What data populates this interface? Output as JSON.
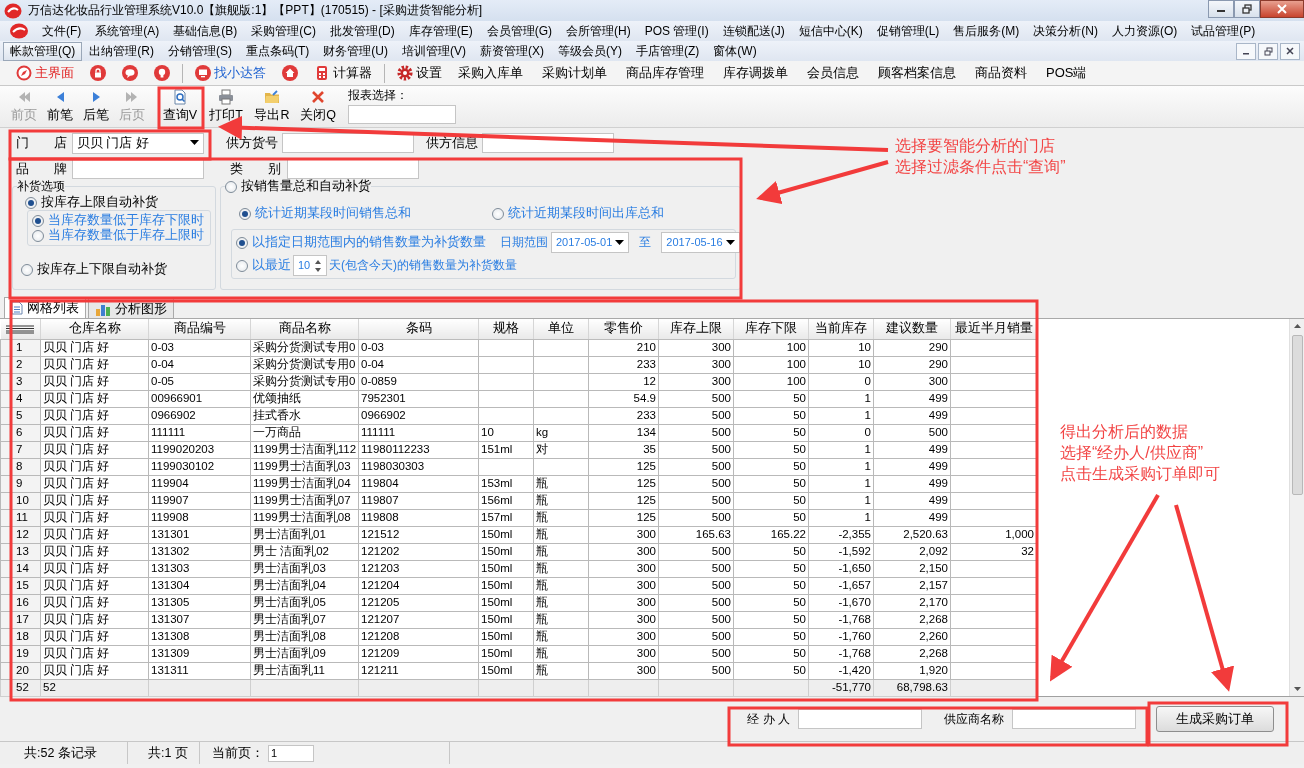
{
  "window": {
    "title": "万信达化妆品行业管理系统V10.0【旗舰版:1】【PPT】(170515) - [采购进货智能分析]"
  },
  "menu_rows": [
    [
      {
        "label": "文件(F)",
        "selected": false
      },
      {
        "label": "系统管理(A)",
        "selected": false
      },
      {
        "label": "基础信息(B)",
        "selected": false
      },
      {
        "label": "采购管理(C)",
        "selected": false
      },
      {
        "label": "批发管理(D)",
        "selected": false
      },
      {
        "label": "库存管理(E)",
        "selected": false
      },
      {
        "label": "会员管理(G)",
        "selected": false
      },
      {
        "label": "会所管理(H)",
        "selected": false
      },
      {
        "label": "POS 管理(I)",
        "selected": false
      },
      {
        "label": "连锁配送(J)",
        "selected": false
      },
      {
        "label": "短信中心(K)",
        "selected": false
      },
      {
        "label": "促销管理(L)",
        "selected": false
      },
      {
        "label": "售后服务(M)",
        "selected": false
      },
      {
        "label": "决策分析(N)",
        "selected": false
      },
      {
        "label": "人力资源(O)",
        "selected": false
      },
      {
        "label": "试品管理(P)",
        "selected": false
      }
    ],
    [
      {
        "label": "帐款管理(Q)",
        "selected": true
      },
      {
        "label": "出纳管理(R)",
        "selected": false
      },
      {
        "label": "分销管理(S)",
        "selected": false
      },
      {
        "label": "重点条码(T)",
        "selected": false
      },
      {
        "label": "财务管理(U)",
        "selected": false
      },
      {
        "label": "培训管理(V)",
        "selected": false
      },
      {
        "label": "薪资管理(X)",
        "selected": false
      },
      {
        "label": "等级会员(Y)",
        "selected": false
      },
      {
        "label": "手店管理(Z)",
        "selected": false
      },
      {
        "label": "窗体(W)",
        "selected": false
      }
    ]
  ],
  "quick_toolbar": [
    {
      "kind": "compass",
      "label": "主界面"
    },
    {
      "kind": "lock"
    },
    {
      "kind": "chat"
    },
    {
      "kind": "bulb"
    },
    {
      "kind": "separator"
    },
    {
      "kind": "monitor",
      "label": "找小达答"
    },
    {
      "kind": "home"
    },
    {
      "kind": "calculator",
      "label": "计算器"
    },
    {
      "kind": "separator"
    },
    {
      "kind": "gear",
      "label": "设置"
    },
    {
      "kind": "text",
      "label": "采购入库单"
    },
    {
      "kind": "text",
      "label": "采购计划单"
    },
    {
      "kind": "text",
      "label": "商品库存管理"
    },
    {
      "kind": "text",
      "label": "库存调拨单"
    },
    {
      "kind": "text",
      "label": "会员信息"
    },
    {
      "kind": "text",
      "label": "顾客档案信息"
    },
    {
      "kind": "text",
      "label": "商品资料"
    },
    {
      "kind": "text",
      "label": "POS端"
    }
  ],
  "nav_toolbar": {
    "buttons": [
      {
        "kind": "first",
        "label": "前页",
        "disabled": true
      },
      {
        "kind": "prev",
        "label": "前笔",
        "disabled": false
      },
      {
        "kind": "next",
        "label": "后笔",
        "disabled": false
      },
      {
        "kind": "last",
        "label": "后页",
        "disabled": true
      },
      {
        "kind": "query",
        "label": "查询V",
        "disabled": false
      },
      {
        "kind": "print",
        "label": "打印T",
        "disabled": false
      },
      {
        "kind": "export",
        "label": "导出R",
        "disabled": false
      },
      {
        "kind": "close",
        "label": "关闭Q",
        "disabled": false
      }
    ],
    "report_select": {
      "label": "报表选择："
    }
  },
  "filters": {
    "store": {
      "label": "门 店",
      "value": "贝贝 门店 好"
    },
    "supplier_code": {
      "label": "供方货号"
    },
    "supplier_info": {
      "label": "供方信息"
    },
    "brand": {
      "label": "品 牌"
    },
    "category": {
      "label": "类 别"
    }
  },
  "replenish": {
    "legend": "补货选项",
    "by_stock_limit": {
      "label": "按库存上限自动补货",
      "selected": true,
      "options": [
        {
          "label": "当库存数量低于库存下限时",
          "selected": true
        },
        {
          "label": "当库存数量低于库存上限时",
          "selected": false
        }
      ]
    },
    "by_stock_range": {
      "label": "按库存上下限自动补货",
      "selected": false
    },
    "by_sales": {
      "label": "按销售量总和自动补货",
      "selected": false,
      "sum_options": [
        {
          "label": "统计近期某段时间销售总和",
          "selected": true
        },
        {
          "label": "统计近期某段时间出库总和",
          "selected": false
        }
      ],
      "date_range": {
        "label": "以指定日期范围内的销售数量为补货数量",
        "selected": true,
        "range_label": "日期范围",
        "from": "2017-05-01",
        "to_label": "至",
        "to": "2017-05-16"
      },
      "recent": {
        "prefix": "以最近",
        "days": "10",
        "suffix": "天(包含今天)的销售数量为补货数量",
        "selected": false
      }
    }
  },
  "tabs": [
    {
      "kind": "list",
      "label": "网格列表",
      "selected": true
    },
    {
      "kind": "chart",
      "label": "分析图形",
      "selected": false
    }
  ],
  "table": {
    "columns": [
      "仓库名称",
      "商品编号",
      "商品名称",
      "条码",
      "规格",
      "单位",
      "零售价",
      "库存上限",
      "库存下限",
      "当前库存",
      "建议数量",
      "最近半月销量"
    ],
    "rows": [
      {
        "number": "1",
        "cells": [
          "贝贝 门店 好",
          "0-03",
          "采购分货测试专用0",
          "0-03",
          null,
          null,
          "210",
          "300",
          "100",
          "10",
          "290",
          null
        ]
      },
      {
        "number": "2",
        "cells": [
          "贝贝 门店 好",
          "0-04",
          "采购分货测试专用0",
          "0-04",
          null,
          null,
          "233",
          "300",
          "100",
          "10",
          "290",
          null
        ]
      },
      {
        "number": "3",
        "cells": [
          "贝贝 门店 好",
          "0-05",
          "采购分货测试专用0",
          "0-0859",
          null,
          null,
          "12",
          "300",
          "100",
          "0",
          "300",
          null
        ]
      },
      {
        "number": "4",
        "cells": [
          "贝贝 门店 好",
          "00966901",
          "优颂抽纸",
          "7952301",
          null,
          null,
          "54.9",
          "500",
          "50",
          "1",
          "499",
          null
        ]
      },
      {
        "number": "5",
        "cells": [
          "贝贝 门店 好",
          "0966902",
          "挂式香水",
          "0966902",
          null,
          null,
          "233",
          "500",
          "50",
          "1",
          "499",
          null
        ]
      },
      {
        "number": "6",
        "cells": [
          "贝贝 门店 好",
          "111111",
          "一万商品",
          "111111",
          "10",
          "kg",
          "134",
          "500",
          "50",
          "0",
          "500",
          null
        ]
      },
      {
        "number": "7",
        "cells": [
          "贝贝 门店 好",
          "1199020203",
          "1199男士洁面乳112",
          "11980112233",
          "151ml",
          "对",
          "35",
          "500",
          "50",
          "1",
          "499",
          null
        ]
      },
      {
        "number": "8",
        "cells": [
          "贝贝 门店 好",
          "1199030102",
          "1199男士洁面乳03",
          "1198030303",
          null,
          null,
          "125",
          "500",
          "50",
          "1",
          "499",
          null
        ]
      },
      {
        "number": "9",
        "cells": [
          "贝贝 门店 好",
          "119904",
          "1199男士洁面乳04",
          "119804",
          "153ml",
          "瓶",
          "125",
          "500",
          "50",
          "1",
          "499",
          null
        ]
      },
      {
        "number": "10",
        "cells": [
          "贝贝 门店 好",
          "119907",
          "1199男士洁面乳07",
          "119807",
          "156ml",
          "瓶",
          "125",
          "500",
          "50",
          "1",
          "499",
          null
        ]
      },
      {
        "number": "11",
        "cells": [
          "贝贝 门店 好",
          "119908",
          "1199男士洁面乳08",
          "119808",
          "157ml",
          "瓶",
          "125",
          "500",
          "50",
          "1",
          "499",
          null
        ]
      },
      {
        "number": "12",
        "cells": [
          "贝贝 门店 好",
          "131301",
          "男士洁面乳01",
          "121512",
          "150ml",
          "瓶",
          "300",
          "165.63",
          "165.22",
          "-2,355",
          "2,520.63",
          "1,000"
        ]
      },
      {
        "number": "13",
        "cells": [
          "贝贝 门店 好",
          "131302",
          "男士 洁面乳02",
          "121202",
          "150ml",
          "瓶",
          "300",
          "500",
          "50",
          "-1,592",
          "2,092",
          "32"
        ]
      },
      {
        "number": "14",
        "cells": [
          "贝贝 门店 好",
          "131303",
          "男士洁面乳03",
          "121203",
          "150ml",
          "瓶",
          "300",
          "500",
          "50",
          "-1,650",
          "2,150",
          null
        ]
      },
      {
        "number": "15",
        "cells": [
          "贝贝 门店 好",
          "131304",
          "男士洁面乳04",
          "121204",
          "150ml",
          "瓶",
          "300",
          "500",
          "50",
          "-1,657",
          "2,157",
          null
        ]
      },
      {
        "number": "16",
        "cells": [
          "贝贝 门店 好",
          "131305",
          "男士洁面乳05",
          "121205",
          "150ml",
          "瓶",
          "300",
          "500",
          "50",
          "-1,670",
          "2,170",
          null
        ]
      },
      {
        "number": "17",
        "cells": [
          "贝贝 门店 好",
          "131307",
          "男士洁面乳07",
          "121207",
          "150ml",
          "瓶",
          "300",
          "500",
          "50",
          "-1,768",
          "2,268",
          null
        ]
      },
      {
        "number": "18",
        "cells": [
          "贝贝 门店 好",
          "131308",
          "男士洁面乳08",
          "121208",
          "150ml",
          "瓶",
          "300",
          "500",
          "50",
          "-1,760",
          "2,260",
          null
        ]
      },
      {
        "number": "19",
        "cells": [
          "贝贝 门店 好",
          "131309",
          "男士洁面乳09",
          "121209",
          "150ml",
          "瓶",
          "300",
          "500",
          "50",
          "-1,768",
          "2,268",
          null
        ]
      },
      {
        "number": "20",
        "cells": [
          "贝贝 门店 好",
          "131311",
          "男士洁面乳11",
          "121211",
          "150ml",
          "瓶",
          "300",
          "500",
          "50",
          "-1,420",
          "1,920",
          null
        ]
      }
    ],
    "footer": {
      "row_number": "52",
      "count": "52",
      "current_stock_total": "-51,770",
      "suggested_total": "68,798.63"
    }
  },
  "order_panel": {
    "handler": {
      "label": "经 办 人"
    },
    "supplier": {
      "label": "供应商名称"
    },
    "button": "生成采购订单"
  },
  "status_bar": {
    "records": "共:52 条记录",
    "pages": "共:1 页",
    "current_page_label": "当前页：",
    "current_page": "1"
  },
  "annotations": [
    {
      "lines": [
        "选择要智能分析的门店",
        "选择过滤条件点击“查询”"
      ]
    },
    {
      "lines": [
        "得出分析后的数据",
        "选择“经办人/供应商”",
        "点击生成采购订单即可"
      ]
    }
  ]
}
